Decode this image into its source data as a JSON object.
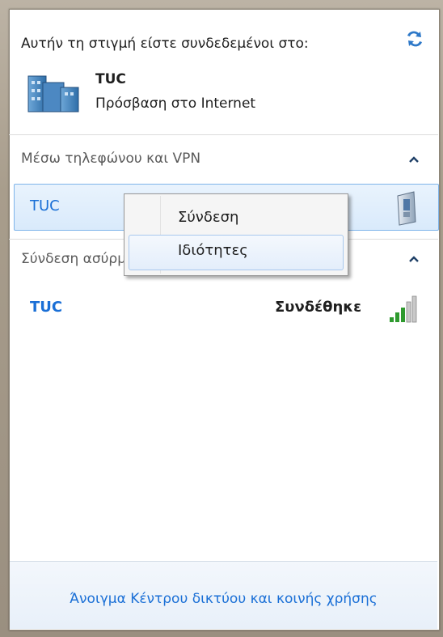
{
  "header": {
    "title": "Αυτήν τη στιγμή είστε συνδεδεμένοι στο:",
    "refresh_icon": "refresh-icon"
  },
  "current_network": {
    "name": "TUC",
    "status": "Πρόσβαση στο Internet"
  },
  "sections": {
    "dialup_vpn": {
      "label": "Μέσω τηλεφώνου και VPN",
      "items": [
        {
          "name": "TUC"
        }
      ]
    },
    "wireless": {
      "label": "Σύνδεση ασύρματου δικτύου",
      "items": [
        {
          "name": "TUC",
          "status": "Συνδέθηκε"
        }
      ]
    }
  },
  "context_menu": {
    "items": [
      {
        "label": "Σύνδεση"
      },
      {
        "label": "Ιδιότητες",
        "hovered": true
      }
    ]
  },
  "footer": {
    "link": "Άνοιγμα Κέντρου δικτύου και κοινής χρήσης"
  },
  "colors": {
    "link_blue": "#1a6fd6",
    "selection_border": "#7eb4ea",
    "signal_green": "#2e9a2e"
  }
}
